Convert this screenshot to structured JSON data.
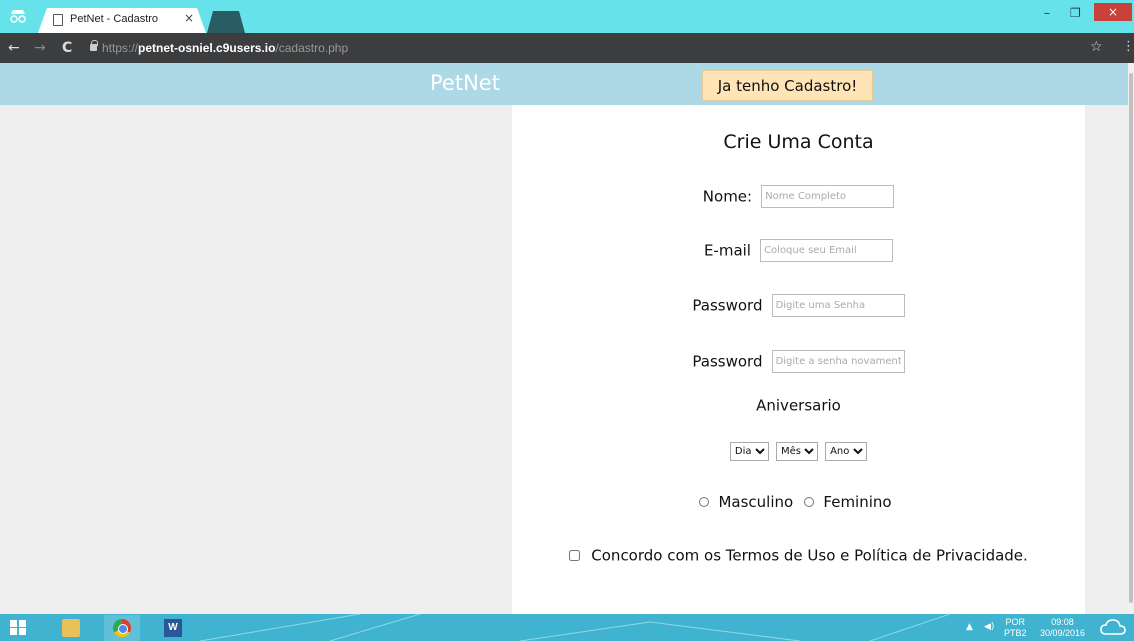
{
  "browser": {
    "tab_title": "PetNet - Cadastro",
    "tab_close": "×",
    "url_scheme": "https://",
    "url_host": "petnet-osniel.c9users.io",
    "url_path": "/cadastro.php",
    "win_minimize": "–",
    "win_restore": "❐",
    "win_close": "×",
    "back": "←",
    "forward": "→",
    "reload": "C",
    "bookmark": "☆",
    "menu": "⋮"
  },
  "header": {
    "brand": "PetNet",
    "login_button": "Ja tenho Cadastro!"
  },
  "form": {
    "title": "Crie Uma Conta",
    "name_label": "Nome:",
    "name_placeholder": "Nome Completo",
    "email_label": "E-mail",
    "email_placeholder": "Coloque seu Email",
    "password_label": "Password",
    "password_placeholder": "Digite uma Senha",
    "password2_label": "Password",
    "password2_placeholder": "Digite a senha novamente",
    "birthday_label": "Aniversario",
    "day_option": "Dia",
    "month_option": "Mês",
    "year_option": "Ano",
    "male_label": "Masculino",
    "female_label": "Feminino",
    "terms_label": "Concordo com os Termos de Uso e Política de Privacidade."
  },
  "taskbar": {
    "word_label": "W",
    "lang_line1": "POR",
    "lang_line2": "PTB2",
    "time": "09:08",
    "date": "30/09/2016",
    "tray_up": "▲",
    "volume": "◀)"
  },
  "colors": {
    "tabbar": "#66e3ea",
    "header": "#add8e6",
    "login_button": "#ffe4b5",
    "taskbar": "#3fb3cf"
  }
}
